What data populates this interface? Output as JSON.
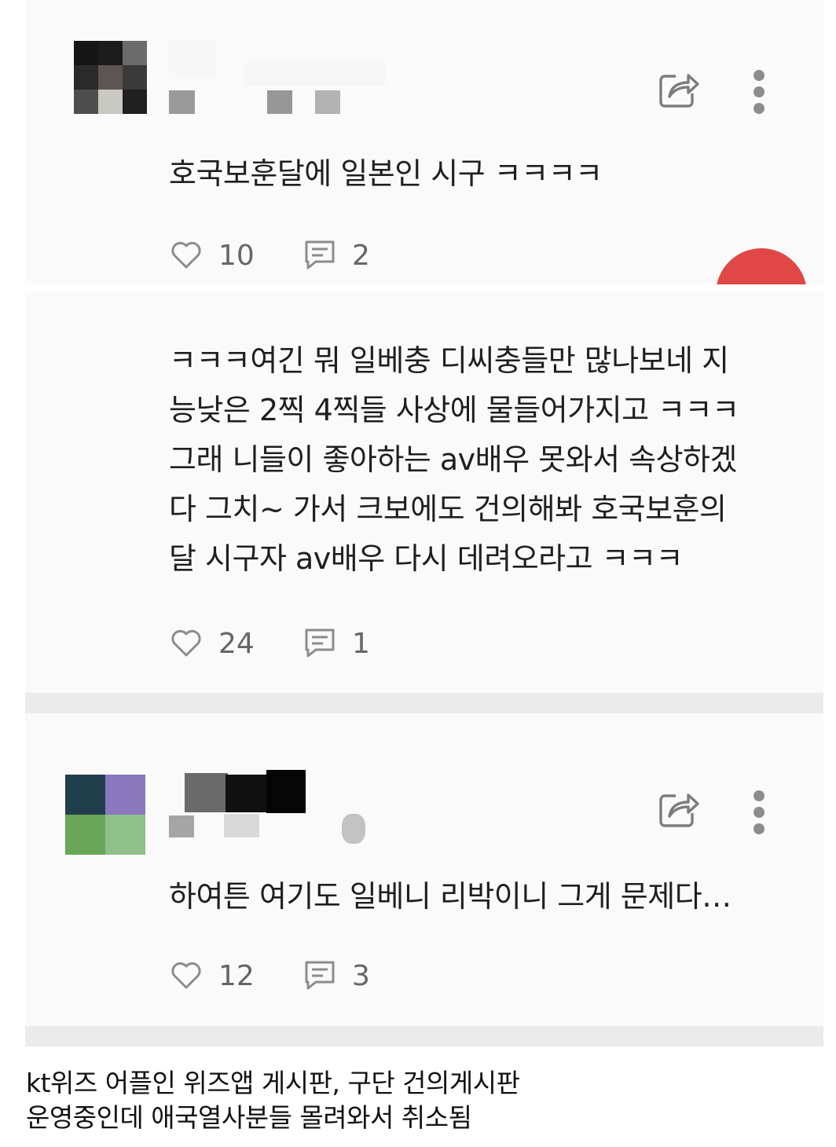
{
  "comments": [
    {
      "text": "호국보훈달에 일본인 시구 ㅋㅋㅋㅋ",
      "likes": "10",
      "replies": "2"
    },
    {
      "text": "ㅋㅋㅋ여긴 뭐 일베충 디씨충들만 많나보네 지\n능낮은 2찍 4찍들 사상에 물들어가지고 ㅋㅋㅋ\n그래 니들이 좋아하는 av배우 못와서 속상하겠\n다 그치~ 가서 크보에도 건의해봐 호국보훈의\n달 시구자 av배우 다시 데려오라고 ㅋㅋㅋ",
      "likes": "24",
      "replies": "1"
    },
    {
      "text": "하여튼 여기도 일베니 리박이니 그게 문제다…",
      "likes": "12",
      "replies": "3"
    }
  ],
  "caption": {
    "line1": "kt위즈 어플인 위즈앱 게시판, 구단 건의게시판",
    "line2": "운영중인데 애국열사분들 몰려와서 취소됨"
  },
  "icons": {
    "share": "share-icon",
    "more": "more-vertical-icon",
    "like": "heart-icon",
    "reply": "comment-icon"
  },
  "colors": {
    "panel_bg": "#fafafa",
    "separator": "#ebebeb",
    "icon_gray": "#8c8c8c",
    "count_gray": "#666666",
    "red_button": "#e04848"
  }
}
